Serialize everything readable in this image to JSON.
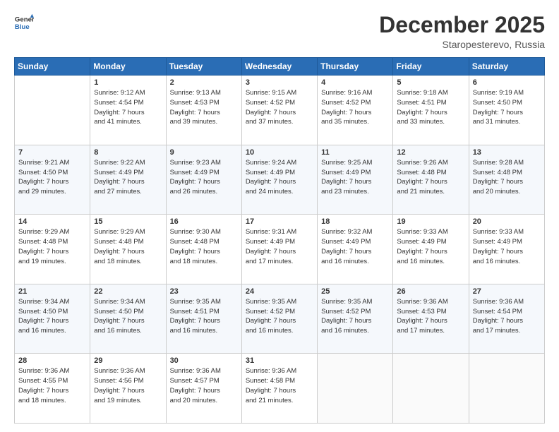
{
  "logo": {
    "line1": "General",
    "line2": "Blue"
  },
  "header": {
    "month": "December 2025",
    "location": "Staropesterevo, Russia"
  },
  "weekdays": [
    "Sunday",
    "Monday",
    "Tuesday",
    "Wednesday",
    "Thursday",
    "Friday",
    "Saturday"
  ],
  "weeks": [
    [
      {
        "day": "",
        "info": ""
      },
      {
        "day": "1",
        "info": "Sunrise: 9:12 AM\nSunset: 4:54 PM\nDaylight: 7 hours\nand 41 minutes."
      },
      {
        "day": "2",
        "info": "Sunrise: 9:13 AM\nSunset: 4:53 PM\nDaylight: 7 hours\nand 39 minutes."
      },
      {
        "day": "3",
        "info": "Sunrise: 9:15 AM\nSunset: 4:52 PM\nDaylight: 7 hours\nand 37 minutes."
      },
      {
        "day": "4",
        "info": "Sunrise: 9:16 AM\nSunset: 4:52 PM\nDaylight: 7 hours\nand 35 minutes."
      },
      {
        "day": "5",
        "info": "Sunrise: 9:18 AM\nSunset: 4:51 PM\nDaylight: 7 hours\nand 33 minutes."
      },
      {
        "day": "6",
        "info": "Sunrise: 9:19 AM\nSunset: 4:50 PM\nDaylight: 7 hours\nand 31 minutes."
      }
    ],
    [
      {
        "day": "7",
        "info": ""
      },
      {
        "day": "8",
        "info": "Sunrise: 9:22 AM\nSunset: 4:49 PM\nDaylight: 7 hours\nand 27 minutes."
      },
      {
        "day": "9",
        "info": "Sunrise: 9:23 AM\nSunset: 4:49 PM\nDaylight: 7 hours\nand 26 minutes."
      },
      {
        "day": "10",
        "info": "Sunrise: 9:24 AM\nSunset: 4:49 PM\nDaylight: 7 hours\nand 24 minutes."
      },
      {
        "day": "11",
        "info": "Sunrise: 9:25 AM\nSunset: 4:49 PM\nDaylight: 7 hours\nand 23 minutes."
      },
      {
        "day": "12",
        "info": "Sunrise: 9:26 AM\nSunset: 4:48 PM\nDaylight: 7 hours\nand 21 minutes."
      },
      {
        "day": "13",
        "info": "Sunrise: 9:28 AM\nSunset: 4:48 PM\nDaylight: 7 hours\nand 20 minutes."
      }
    ],
    [
      {
        "day": "14",
        "info": ""
      },
      {
        "day": "15",
        "info": "Sunrise: 9:29 AM\nSunset: 4:48 PM\nDaylight: 7 hours\nand 18 minutes."
      },
      {
        "day": "16",
        "info": "Sunrise: 9:30 AM\nSunset: 4:48 PM\nDaylight: 7 hours\nand 18 minutes."
      },
      {
        "day": "17",
        "info": "Sunrise: 9:31 AM\nSunset: 4:49 PM\nDaylight: 7 hours\nand 17 minutes."
      },
      {
        "day": "18",
        "info": "Sunrise: 9:32 AM\nSunset: 4:49 PM\nDaylight: 7 hours\nand 16 minutes."
      },
      {
        "day": "19",
        "info": "Sunrise: 9:33 AM\nSunset: 4:49 PM\nDaylight: 7 hours\nand 16 minutes."
      },
      {
        "day": "20",
        "info": "Sunrise: 9:33 AM\nSunset: 4:49 PM\nDaylight: 7 hours\nand 16 minutes."
      }
    ],
    [
      {
        "day": "21",
        "info": ""
      },
      {
        "day": "22",
        "info": "Sunrise: 9:34 AM\nSunset: 4:50 PM\nDaylight: 7 hours\nand 16 minutes."
      },
      {
        "day": "23",
        "info": "Sunrise: 9:35 AM\nSunset: 4:51 PM\nDaylight: 7 hours\nand 16 minutes."
      },
      {
        "day": "24",
        "info": "Sunrise: 9:35 AM\nSunset: 4:52 PM\nDaylight: 7 hours\nand 16 minutes."
      },
      {
        "day": "25",
        "info": "Sunrise: 9:35 AM\nSunset: 4:52 PM\nDaylight: 7 hours\nand 16 minutes."
      },
      {
        "day": "26",
        "info": "Sunrise: 9:36 AM\nSunset: 4:53 PM\nDaylight: 7 hours\nand 17 minutes."
      },
      {
        "day": "27",
        "info": "Sunrise: 9:36 AM\nSunset: 4:54 PM\nDaylight: 7 hours\nand 17 minutes."
      }
    ],
    [
      {
        "day": "28",
        "info": "Sunrise: 9:36 AM\nSunset: 4:55 PM\nDaylight: 7 hours\nand 18 minutes."
      },
      {
        "day": "29",
        "info": "Sunrise: 9:36 AM\nSunset: 4:56 PM\nDaylight: 7 hours\nand 19 minutes."
      },
      {
        "day": "30",
        "info": "Sunrise: 9:36 AM\nSunset: 4:57 PM\nDaylight: 7 hours\nand 20 minutes."
      },
      {
        "day": "31",
        "info": "Sunrise: 9:36 AM\nSunset: 4:58 PM\nDaylight: 7 hours\nand 21 minutes."
      },
      {
        "day": "",
        "info": ""
      },
      {
        "day": "",
        "info": ""
      },
      {
        "day": "",
        "info": ""
      }
    ]
  ],
  "week7_sunday": "Sunrise: 9:21 AM\nSunset: 4:50 PM\nDaylight: 7 hours\nand 29 minutes.",
  "week14_sunday": "Sunrise: 9:29 AM\nSunset: 4:48 PM\nDaylight: 7 hours\nand 19 minutes.",
  "week21_sunday": "Sunrise: 9:34 AM\nSunset: 4:50 PM\nDaylight: 7 hours\nand 16 minutes."
}
